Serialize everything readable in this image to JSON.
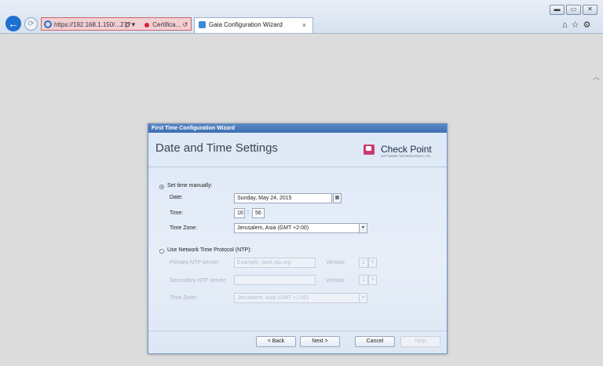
{
  "browser": {
    "address_url": "https://192.168.1.150/...27?",
    "certificate_label": "Certifica...",
    "tab_title": "Gaia Configuration Wizard",
    "tab_close": "×",
    "back_glyph": "←",
    "forward_glyph": "⟳",
    "tools_glyphs": "ρ ▾",
    "refresh_glyph": "↺",
    "top_icons": "⌂☆⚙",
    "window_controls": [
      "▬",
      "▭",
      "✕"
    ]
  },
  "dialog": {
    "window_title": "First Time Configuration Wizard",
    "header_title": "Date and Time Settings",
    "logo": {
      "name": "Check Point",
      "sub": "SOFTWARE TECHNOLOGIES LTD."
    },
    "manual": {
      "label": "Set time manually:",
      "selected": true,
      "date_label": "Date:",
      "date_value": "Sunday, May 24, 2015",
      "time_label": "Time:",
      "hour": "16",
      "minute": "56",
      "timezone_label": "Time Zone:",
      "timezone_value": "Jerusalem, Asia (GMT +2:00)"
    },
    "ntp": {
      "label": "Use Network Time Protocol (NTP):",
      "selected": false,
      "primary_label": "Primary NTP server:",
      "primary_placeholder": "Example: pool.ntp.org",
      "secondary_label": "Secondary NTP server:",
      "version_label": "Version:",
      "version_value": "1",
      "timezone_label": "Time Zone:",
      "timezone_value": "Jerusalem, Asia (GMT +2:00)"
    },
    "buttons": {
      "back": "< Back",
      "next": "Next >",
      "cancel": "Cancel",
      "help": "Help"
    }
  },
  "icons": {
    "calendar": "calendar-icon",
    "dropdown": "chevron-down-icon",
    "spinner": "spinner-icon"
  },
  "colors": {
    "dialog_title_bar": "#3e6fb2",
    "logo": "#c93b6e",
    "back_button": "#1f6fd0",
    "address_bar": "#f3cfd4"
  }
}
